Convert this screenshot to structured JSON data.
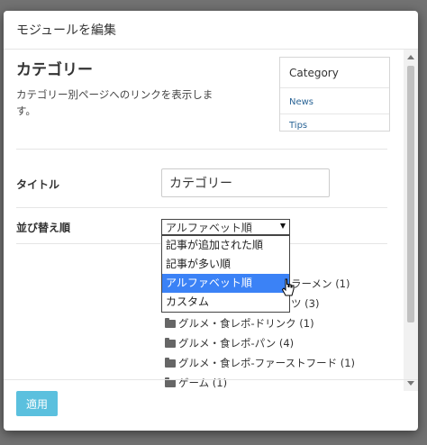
{
  "modal": {
    "title": "モジュールを編集",
    "heading": "カテゴリー",
    "description": "カテゴリー別ページへのリンクを表示します。",
    "apply_label": "適用"
  },
  "preview": {
    "title": "Category",
    "links": [
      "News",
      "Tips"
    ]
  },
  "form": {
    "title_label": "タイトル",
    "title_value": "カテゴリー",
    "sort_label": "並び替え順",
    "sort_selected": "アルファベット順",
    "sort_options": [
      "記事が追加された順",
      "記事が多い順",
      "アルファベット順",
      "カスタム"
    ]
  },
  "categories": [
    "ラーメン (1)",
    "ツ (3)",
    "グルメ・食レポ-ドリンク (1)",
    "グルメ・食レポ-パン (4)",
    "グルメ・食レポ-ファーストフード (1)",
    "ゲーム (1)"
  ],
  "colors": {
    "apply": "#5bc0de",
    "selected_option": "#3b82f6",
    "link": "#2a6496"
  }
}
